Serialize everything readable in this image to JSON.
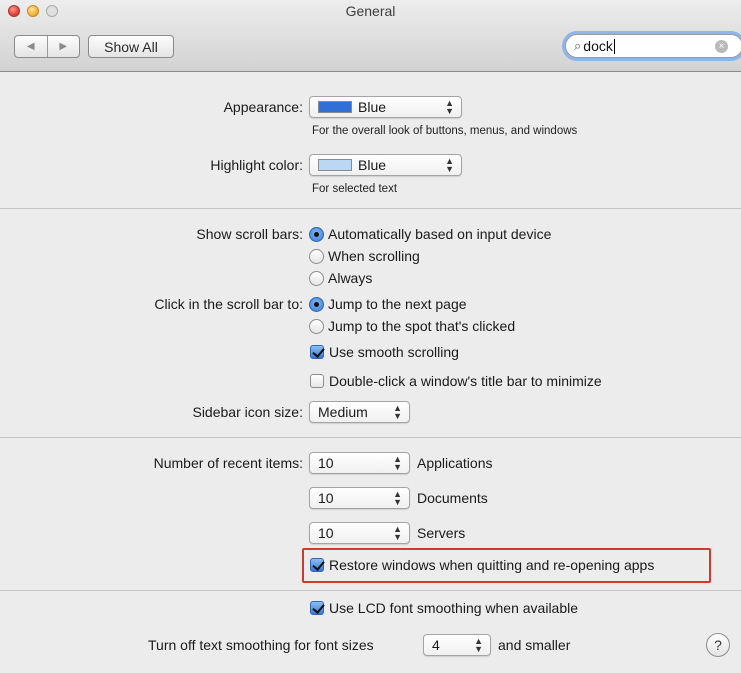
{
  "window": {
    "title": "General",
    "back_icon": "◀",
    "forward_icon": "▶",
    "show_all_label": "Show All",
    "search_value": "dock",
    "search_icon": "⌕",
    "clear_icon": "×"
  },
  "appearance": {
    "label": "Appearance:",
    "value": "Blue",
    "swatch_color": "#2f6fd6",
    "hint": "For the overall look of buttons, menus, and windows"
  },
  "highlight": {
    "label": "Highlight color:",
    "value": "Blue",
    "swatch_color": "#bcd6f5",
    "hint": "For selected text"
  },
  "scroll_bars": {
    "label": "Show scroll bars:",
    "options": [
      {
        "label": "Automatically based on input device",
        "selected": true
      },
      {
        "label": "When scrolling",
        "selected": false
      },
      {
        "label": "Always",
        "selected": false
      }
    ]
  },
  "click_scroll": {
    "label": "Click in the scroll bar to:",
    "options": [
      {
        "label": "Jump to the next page",
        "selected": true
      },
      {
        "label": "Jump to the spot that's clicked",
        "selected": false
      }
    ]
  },
  "smooth_scrolling": {
    "label": "Use smooth scrolling",
    "checked": true
  },
  "double_click": {
    "label": "Double-click a window's title bar to minimize",
    "checked": false
  },
  "sidebar_icon": {
    "label": "Sidebar icon size:",
    "value": "Medium"
  },
  "recent_items": {
    "label": "Number of recent items:",
    "rows": [
      {
        "value": "10",
        "label": "Applications"
      },
      {
        "value": "10",
        "label": "Documents"
      },
      {
        "value": "10",
        "label": "Servers"
      }
    ]
  },
  "restore_windows": {
    "label": "Restore windows when quitting and re-opening apps",
    "checked": true
  },
  "lcd_smoothing": {
    "label": "Use LCD font smoothing when available",
    "checked": true
  },
  "text_smoothing": {
    "prefix": "Turn off text smoothing for font sizes",
    "value": "4",
    "suffix": "and smaller"
  },
  "help_label": "?",
  "popup_arrows": "▲\n▼"
}
